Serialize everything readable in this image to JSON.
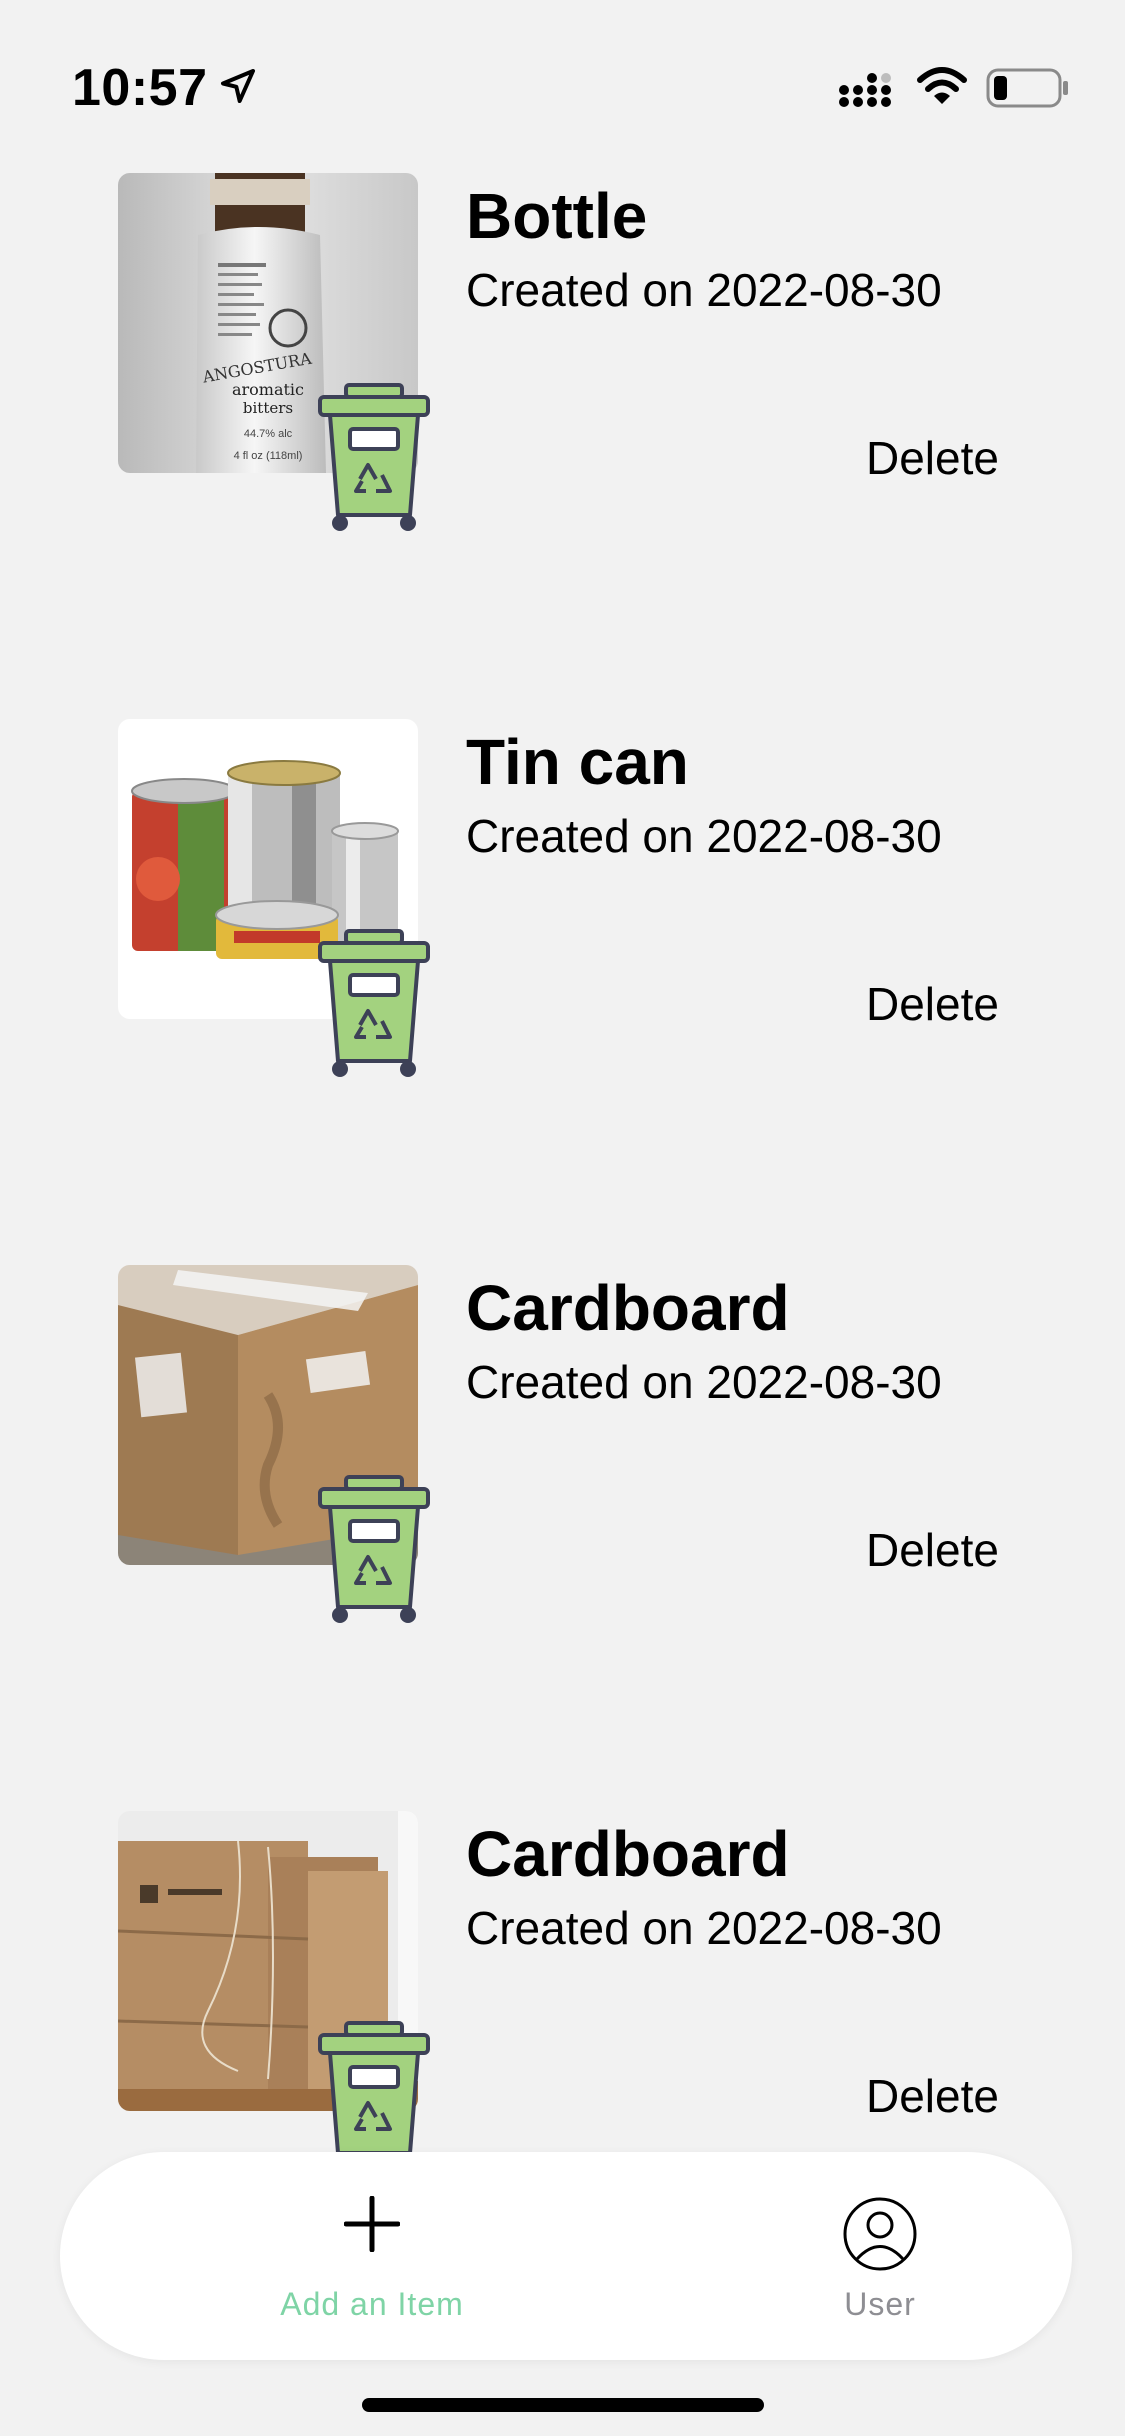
{
  "status_bar": {
    "time": "10:57",
    "icons": [
      "location-arrow-icon",
      "cellular-signal-icon",
      "wifi-icon",
      "battery-low-icon"
    ]
  },
  "items": [
    {
      "title": "Bottle",
      "date_text": "Created on 2022-08-30",
      "delete_label": "Delete",
      "thumbnail": "bottle-photo",
      "badge_icon": "recycle-bin-icon"
    },
    {
      "title": "Tin can",
      "date_text": "Created on 2022-08-30",
      "delete_label": "Delete",
      "thumbnail": "tin-can-photo",
      "badge_icon": "recycle-bin-icon"
    },
    {
      "title": "Cardboard",
      "date_text": "Created on 2022-08-30",
      "delete_label": "Delete",
      "thumbnail": "cardboard-box-photo",
      "badge_icon": "recycle-bin-icon"
    },
    {
      "title": "Cardboard",
      "date_text": "Created on 2022-08-30",
      "delete_label": "Delete",
      "thumbnail": "cardboard-sheets-photo",
      "badge_icon": "recycle-bin-icon"
    }
  ],
  "tab_bar": {
    "add": {
      "label": "Add an Item",
      "icon": "plus-icon",
      "color": "#7fd4a6"
    },
    "user": {
      "label": "User",
      "icon": "user-circle-icon",
      "color": "#8e8e93"
    }
  },
  "colors": {
    "background": "#f2f2f2",
    "bin_green": "#a3d27f",
    "bin_outline": "#3d4157"
  }
}
